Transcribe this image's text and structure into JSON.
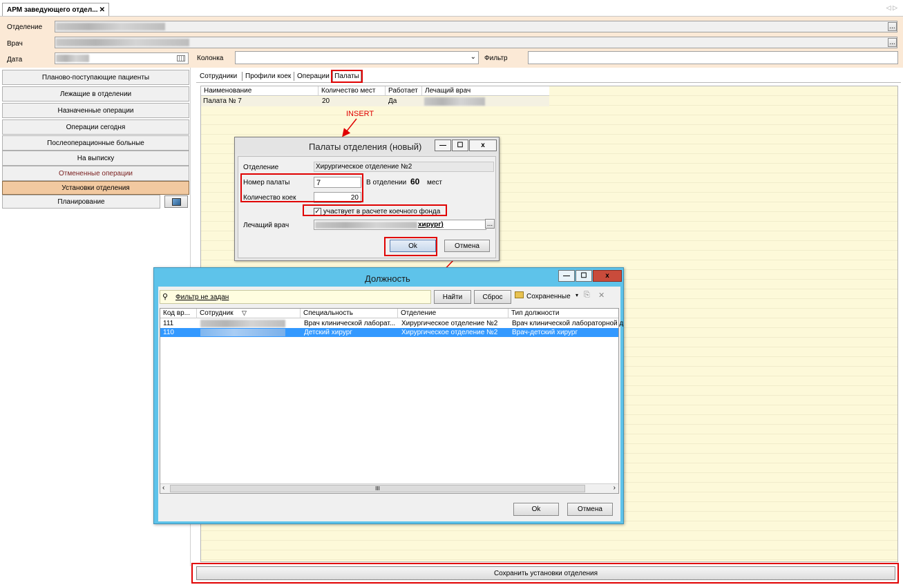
{
  "tab": {
    "title": "АРМ заведующего отдел...",
    "close": "✕",
    "nav": "◁ ▷"
  },
  "filters": {
    "department_label": "Отделение",
    "doctor_label": "Врач",
    "date_label": "Дата",
    "column_label": "Колонка",
    "filter_label": "Фильтр",
    "ellipsis": "..."
  },
  "sidebar": {
    "items": [
      {
        "label": "Планово-поступающие пациенты"
      },
      {
        "label": "Лежащие в отделении"
      },
      {
        "label": "Назначенные операции"
      },
      {
        "label": "Операции сегодня"
      },
      {
        "label": "Послеоперационные больные"
      },
      {
        "label": "На выписку"
      },
      {
        "label": "Отмененные операции"
      },
      {
        "label": "Установки отделения"
      },
      {
        "label": "Планирование"
      }
    ]
  },
  "main_tabs": [
    "Сотрудники",
    "Профили коек",
    "Операции",
    "Палаты"
  ],
  "wards_table": {
    "headers": [
      "Наименование",
      "Количество мест",
      "Работает",
      "Лечащий врач"
    ],
    "rows": [
      {
        "name": "Палата № 7",
        "places": "20",
        "works": "Да"
      }
    ]
  },
  "annotation": "INSERT",
  "ward_dialog": {
    "title": "Палаты отделения (новый)",
    "department_label": "Отделение",
    "department_value": "Хирургическое отделение №2",
    "ward_number_label": "Номер палаты",
    "ward_number_value": "7",
    "in_department_label": "В отделении",
    "in_department_count": "60",
    "places_label": "мест",
    "beds_label": "Количество коек",
    "beds_value": "20",
    "checkbox_label": "участвует в расчете коечного фонда",
    "doctor_label": "Лечащий врач",
    "doctor_value": "хирург)",
    "ok": "Ok",
    "cancel": "Отмена",
    "ellipsis": "..."
  },
  "position_dialog": {
    "title": "Должность",
    "filter_link": "Фильтр не задан",
    "find": "Найти",
    "reset": "Сброс",
    "saved": "Сохраненные",
    "headers": [
      "Код вр...",
      "Сотрудник",
      "Специальность",
      "Отделение",
      "Тип должности"
    ],
    "rows": [
      {
        "code": "111",
        "specialty": "Врач клинической лаборат...",
        "department": "Хирургическое отделение №2",
        "type": "Врач клинической лабораторной д"
      },
      {
        "code": "110",
        "specialty": "Детский хирург",
        "department": "Хирургическое отделение №2",
        "type": "Врач-детский хирург"
      }
    ],
    "scroll_mark": "III",
    "ok": "Ok",
    "cancel": "Отмена"
  },
  "save_button": "Сохранить установки отделения",
  "colors": {
    "selection": "#3399ff",
    "accent_red": "#e00000",
    "grid_bg": "#fdf9d9",
    "dialog_title": "#5ec3ea"
  }
}
